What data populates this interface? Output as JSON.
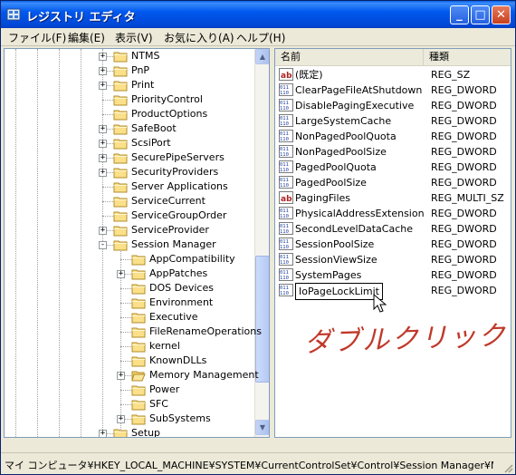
{
  "window": {
    "title": "レジストリ エディタ",
    "btn_min": "_",
    "btn_max": "□",
    "btn_close": "✕"
  },
  "menu": [
    "ファイル(F)",
    "編集(E)",
    "表示(V)",
    "お気に入り(A)",
    "ヘルプ(H)"
  ],
  "tree": {
    "items": [
      {
        "label": "NTMS",
        "expander": "+"
      },
      {
        "label": "PnP",
        "expander": "+"
      },
      {
        "label": "Print",
        "expander": "+"
      },
      {
        "label": "PriorityControl",
        "expander": ""
      },
      {
        "label": "ProductOptions",
        "expander": ""
      },
      {
        "label": "SafeBoot",
        "expander": "+"
      },
      {
        "label": "ScsiPort",
        "expander": "+"
      },
      {
        "label": "SecurePipeServers",
        "expander": "+"
      },
      {
        "label": "SecurityProviders",
        "expander": "+"
      },
      {
        "label": "Server Applications",
        "expander": ""
      },
      {
        "label": "ServiceCurrent",
        "expander": ""
      },
      {
        "label": "ServiceGroupOrder",
        "expander": ""
      },
      {
        "label": "ServiceProvider",
        "expander": "+"
      },
      {
        "label": "Session Manager",
        "expander": "-"
      },
      {
        "label": "AppCompatibility",
        "expander": ""
      },
      {
        "label": "AppPatches",
        "expander": "+"
      },
      {
        "label": "DOS Devices",
        "expander": ""
      },
      {
        "label": "Environment",
        "expander": ""
      },
      {
        "label": "Executive",
        "expander": ""
      },
      {
        "label": "FileRenameOperations",
        "expander": ""
      },
      {
        "label": "kernel",
        "expander": ""
      },
      {
        "label": "KnownDLLs",
        "expander": ""
      },
      {
        "label": "Memory Management",
        "expander": "+"
      },
      {
        "label": "Power",
        "expander": ""
      },
      {
        "label": "SFC",
        "expander": ""
      },
      {
        "label": "SubSystems",
        "expander": "+"
      },
      {
        "label": "Setup",
        "expander": "+"
      }
    ]
  },
  "list": {
    "col_name": "名前",
    "col_type": "種類",
    "rows": [
      {
        "name": "(既定)",
        "type": "REG_SZ",
        "icon": "string-value-icon"
      },
      {
        "name": "ClearPageFileAtShutdown",
        "type": "REG_DWORD",
        "icon": "binary-value-icon"
      },
      {
        "name": "DisablePagingExecutive",
        "type": "REG_DWORD",
        "icon": "binary-value-icon"
      },
      {
        "name": "LargeSystemCache",
        "type": "REG_DWORD",
        "icon": "binary-value-icon"
      },
      {
        "name": "NonPagedPoolQuota",
        "type": "REG_DWORD",
        "icon": "binary-value-icon"
      },
      {
        "name": "NonPagedPoolSize",
        "type": "REG_DWORD",
        "icon": "binary-value-icon"
      },
      {
        "name": "PagedPoolQuota",
        "type": "REG_DWORD",
        "icon": "binary-value-icon"
      },
      {
        "name": "PagedPoolSize",
        "type": "REG_DWORD",
        "icon": "binary-value-icon"
      },
      {
        "name": "PagingFiles",
        "type": "REG_MULTI_SZ",
        "icon": "string-value-icon"
      },
      {
        "name": "PhysicalAddressExtension",
        "type": "REG_DWORD",
        "icon": "binary-value-icon"
      },
      {
        "name": "SecondLevelDataCache",
        "type": "REG_DWORD",
        "icon": "binary-value-icon"
      },
      {
        "name": "SessionPoolSize",
        "type": "REG_DWORD",
        "icon": "binary-value-icon"
      },
      {
        "name": "SessionViewSize",
        "type": "REG_DWORD",
        "icon": "binary-value-icon"
      },
      {
        "name": "SystemPages",
        "type": "REG_DWORD",
        "icon": "binary-value-icon"
      },
      {
        "name": "IoPageLockLimit",
        "type": "REG_DWORD",
        "icon": "binary-value-icon"
      }
    ]
  },
  "annotation": "ダブルクリック",
  "status": "マイ コンピュータ¥HKEY_LOCAL_MACHINE¥SYSTEM¥CurrentControlSet¥Control¥Session Manager¥Memory Management"
}
